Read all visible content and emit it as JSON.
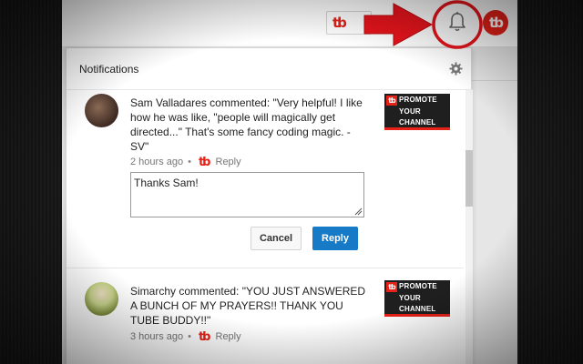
{
  "topbar": {
    "tb_button_logo": "tb",
    "avatar_logo": "tb"
  },
  "notifications": {
    "title": "Notifications",
    "items": [
      {
        "comment": "Sam Valladares commented: \"Very helpful! I like how he was like, \"people will magically get directed...\" That's some fancy coding magic. -SV\"",
        "time": "2 hours ago",
        "separator": "•",
        "tb_logo": "tb",
        "reply_label": "Reply",
        "thumbnail": {
          "badge": "tb",
          "line1": "PROMOTE",
          "line2": "YOUR",
          "line3": "CHANNEL"
        },
        "reply_value": "Thanks Sam!",
        "cancel_label": "Cancel",
        "reply_button_label": "Reply"
      },
      {
        "comment": "Simarchy commented: \"YOU JUST ANSWERED A BUNCH OF MY PRAYERS!! THANK YOU TUBE BUDDY!!\"",
        "time": "3 hours ago",
        "separator": "•",
        "tb_logo": "tb",
        "reply_label": "Reply",
        "thumbnail": {
          "badge": "tb",
          "line1": "PROMOTE",
          "line2": "YOUR",
          "line3": "CHANNEL"
        }
      }
    ]
  },
  "colors": {
    "accent_red": "#e62117",
    "reply_blue": "#167ac6",
    "annotation_red": "#e8141c"
  },
  "icons": {
    "bell": "bell-icon",
    "gear": "gear-icon",
    "arrow": "red-arrow-annotation",
    "circle": "red-circle-annotation"
  }
}
